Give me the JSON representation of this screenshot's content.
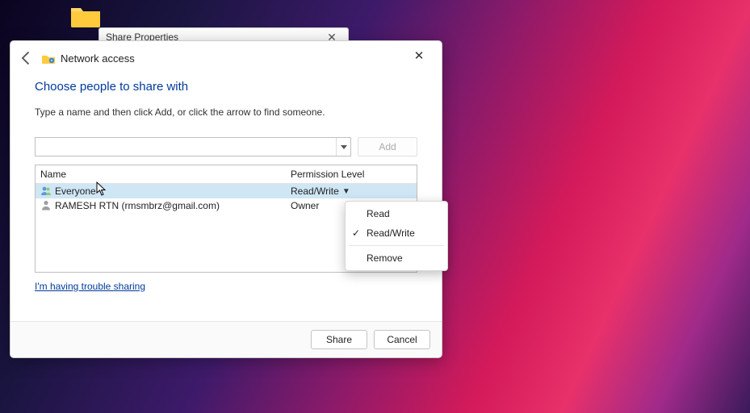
{
  "desktop": {
    "folder_label": ""
  },
  "bg_window": {
    "title": "Share Properties"
  },
  "dialog": {
    "title": "Network access",
    "heading": "Choose people to share with",
    "subtext": "Type a name and then click Add, or click the arrow to find someone.",
    "combo_value": "",
    "add_label": "Add",
    "columns": {
      "name": "Name",
      "permission": "Permission Level"
    },
    "rows": [
      {
        "name": "Everyone",
        "permission": "Read/Write",
        "selected": true,
        "has_dropdown": true,
        "icon": "everyone"
      },
      {
        "name": "RAMESH RTN (rmsmbrz@gmail.com)",
        "permission": "Owner",
        "selected": false,
        "has_dropdown": false,
        "icon": "user"
      }
    ],
    "trouble_link": "I'm having trouble sharing",
    "share_label": "Share",
    "cancel_label": "Cancel"
  },
  "menu": {
    "read": "Read",
    "readwrite": "Read/Write",
    "remove": "Remove",
    "selected": "readwrite"
  }
}
